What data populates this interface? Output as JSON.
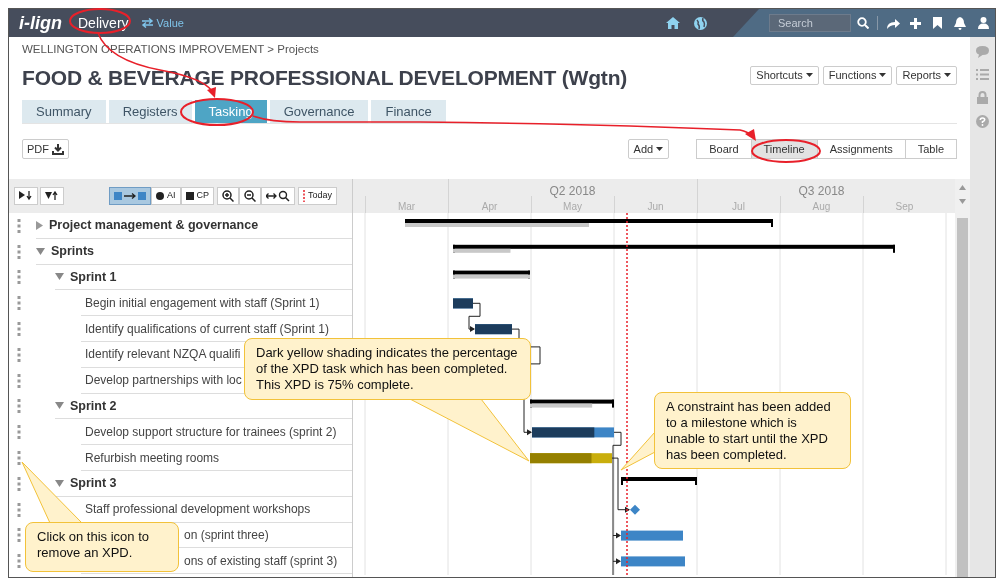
{
  "top_bar": {
    "logo": "i-lign",
    "module": "Delivery",
    "switch_label": "Value",
    "search": {
      "placeholder": "Search"
    }
  },
  "breadcrumb": "WELLINGTON OPERATIONS IMPROVEMENT > Projects",
  "title": "FOOD & BEVERAGE PROFESSIONAL DEVELOPMENT (Wgtn)",
  "header_menus": [
    "Shortcuts",
    "Functions",
    "Reports"
  ],
  "tabs": [
    {
      "label": "Summary",
      "selected": false
    },
    {
      "label": "Registers",
      "selected": false
    },
    {
      "label": "Tasking",
      "selected": true
    },
    {
      "label": "Governance",
      "selected": false
    },
    {
      "label": "Finance",
      "selected": false
    }
  ],
  "pdf_button": "PDF",
  "add_button": "Add",
  "views": [
    {
      "label": "Board",
      "selected": false
    },
    {
      "label": "Timeline",
      "selected": true
    },
    {
      "label": "Assignments",
      "selected": false
    },
    {
      "label": "Table",
      "selected": false
    }
  ],
  "gantt_toolbar": [
    {
      "kind": "expand"
    },
    {
      "kind": "collapse"
    },
    {
      "kind": "links",
      "on": true
    },
    {
      "kind": "ai",
      "label": "AI",
      "on": false
    },
    {
      "kind": "cp",
      "label": "CP",
      "on": false
    },
    {
      "kind": "zoom-in"
    },
    {
      "kind": "zoom-out"
    },
    {
      "kind": "fit"
    },
    {
      "kind": "today",
      "label": "Today"
    }
  ],
  "timeline": {
    "quarters": [
      "Q2 2018",
      "Q3 2018"
    ],
    "months": [
      "Mar",
      "Apr",
      "May",
      "Jun",
      "Jul",
      "Aug",
      "Sep"
    ]
  },
  "tasks": [
    {
      "name": "Project management & governance",
      "expanded": false,
      "kind": "summary",
      "level": 0.5
    },
    {
      "name": "Sprints",
      "expanded": true,
      "kind": "summary",
      "level": 0.13,
      "children": [
        {
          "name": "Sprint 1",
          "expanded": true,
          "kind": "summary",
          "level": 1,
          "children": [
            {
              "name": "Begin initial engagement with staff (Sprint 1)",
              "kind": "task",
              "level": 1
            },
            {
              "name": "Identify qualifications of current staff (Sprint 1)",
              "kind": "task",
              "level": 1
            },
            {
              "name": "Identify relevant NZQA qualifi"
            },
            {
              "name": "Develop partnerships with loc"
            }
          ]
        },
        {
          "name": "Sprint 2",
          "expanded": true,
          "kind": "summary",
          "level": 0.74,
          "children": [
            {
              "name": "Develop support structure for trainees (sprint 2)",
              "kind": "task",
              "level": 0.76
            },
            {
              "name": "Refurbish meeting rooms",
              "kind": "xpd",
              "level": 0.75
            }
          ]
        },
        {
          "name": "Sprint 3",
          "expanded": true,
          "kind": "summary",
          "children": [
            {
              "name": "Staff professional development workshops",
              "kind": "milestone"
            },
            {
              "name": "on (sprint three)",
              "kind": "task"
            },
            {
              "name": "ons of existing staff (sprint 3)",
              "kind": "task"
            }
          ]
        }
      ]
    }
  ],
  "callouts": [
    {
      "text": "Dark yellow shading indicates the percentage of the XPD task which has been completed. This XPD is 75% complete."
    },
    {
      "text": "A constraint has been added to a milestone which is unable to start until the XPD has been completed."
    },
    {
      "text": "Click on this icon to remove an XPD."
    }
  ]
}
